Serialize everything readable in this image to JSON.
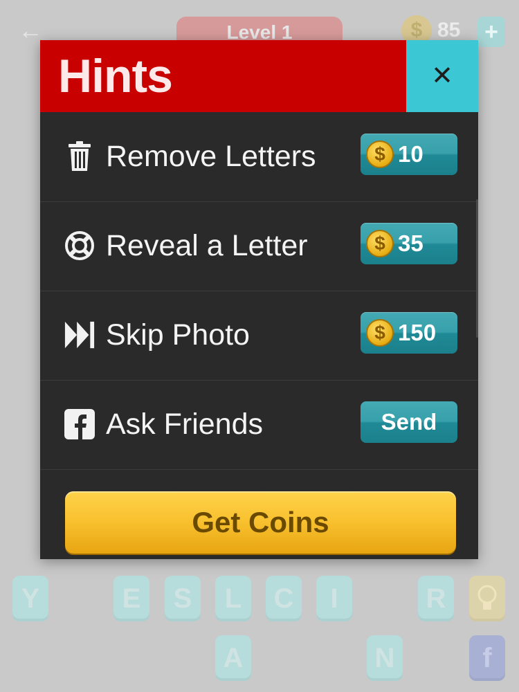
{
  "background": {
    "back_icon": "left-arrow-icon",
    "level_label": "Level 1",
    "coin_count": "85",
    "coin_symbol": "$",
    "plus_label": "+",
    "letter_tiles_row1": [
      "Y",
      "E",
      "S",
      "L",
      "C",
      "I",
      "R"
    ],
    "letter_tiles_row2": [
      "A",
      "N"
    ],
    "hint_tile_icon": "lightbulb-icon",
    "facebook_tile_icon": "facebook-icon",
    "facebook_tile_label": "f"
  },
  "modal": {
    "title": "Hints",
    "close_label": "✕",
    "hints": [
      {
        "icon": "trash-icon",
        "label": "Remove Letters",
        "coin_symbol": "$",
        "price": "10"
      },
      {
        "icon": "lifebuoy-icon",
        "label": "Reveal a Letter",
        "coin_symbol": "$",
        "price": "35"
      },
      {
        "icon": "fast-forward-icon",
        "label": "Skip Photo",
        "coin_symbol": "$",
        "price": "150"
      },
      {
        "icon": "facebook-icon",
        "label": "Ask Friends",
        "action_label": "Send"
      }
    ],
    "get_coins_label": "Get Coins",
    "colors": {
      "header_red": "#c80000",
      "close_cyan": "#3cc7d5",
      "modal_dark": "#2a2a2a",
      "price_teal": "#37a0aa",
      "coin_gold": "#e6ad13",
      "get_coins_yellow": "#f8c02e"
    }
  }
}
